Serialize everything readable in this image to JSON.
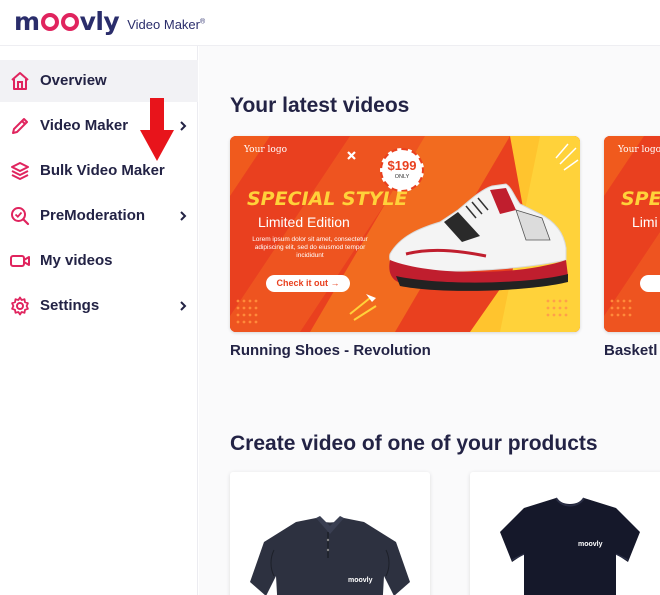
{
  "app": {
    "logo_word": "moovly",
    "logo_subtitle": "Video Maker",
    "logo_reg": "®"
  },
  "sidebar": {
    "items": [
      {
        "label": "Overview",
        "icon": "home-icon",
        "active": true,
        "has_chevron": false
      },
      {
        "label": "Video Maker",
        "icon": "pencil-icon",
        "active": false,
        "has_chevron": true
      },
      {
        "label": "Bulk Video Maker",
        "icon": "layers-icon",
        "active": false,
        "has_chevron": false
      },
      {
        "label": "PreModeration",
        "icon": "search-check-icon",
        "active": false,
        "has_chevron": true
      },
      {
        "label": "My videos",
        "icon": "video-camera-icon",
        "active": false,
        "has_chevron": false
      },
      {
        "label": "Settings",
        "icon": "gear-icon",
        "active": false,
        "has_chevron": true
      }
    ]
  },
  "main": {
    "latest_title": "Your latest videos",
    "videos": [
      {
        "title": "Running Shoes - Revolution",
        "thumbnail": {
          "logo": "Your logo",
          "headline": "SPECIAL STYLE",
          "subheadline": "Limited Edition",
          "body": "Lorem ipsum dolor sit amet, consectetur adipiscing elit, sed do eiusmod tempor incididunt",
          "cta": "Check it out →",
          "price": "$199",
          "price_note": "ONLY"
        }
      },
      {
        "title": "Basketl",
        "thumbnail": {
          "logo": "Your logo",
          "headline": "SPEC",
          "subheadline": "Limi",
          "cta": "Ch"
        }
      }
    ],
    "create_title": "Create video of one of your products",
    "products": [
      {
        "name": "polo-shirt",
        "brand_print": "moovly"
      },
      {
        "name": "t-shirt",
        "brand_print": "moovly"
      }
    ]
  },
  "colors": {
    "brand_navy": "#2a2d6b",
    "brand_pink": "#e0245e",
    "annotation_red": "#e8141b",
    "ad_orange": "#e9401f",
    "ad_yellow": "#ffd23a"
  }
}
